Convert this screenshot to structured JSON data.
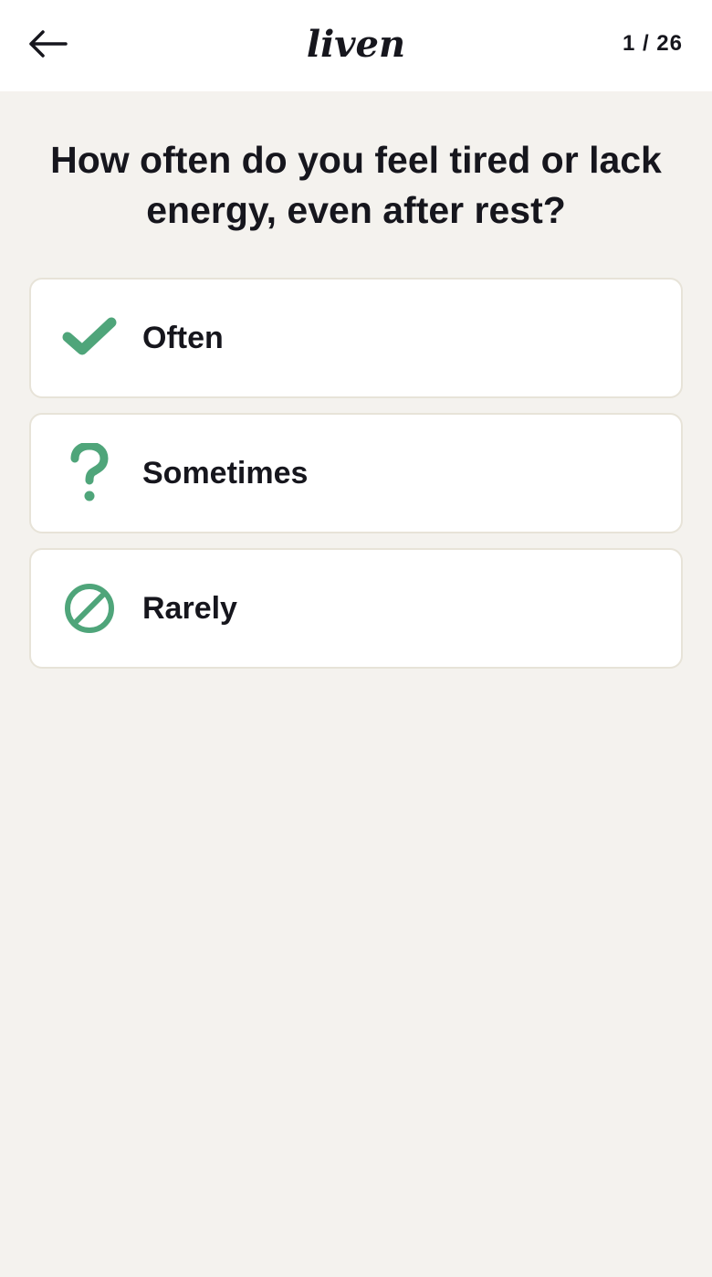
{
  "header": {
    "back_icon": "arrow-left-icon",
    "logo_text": "liven",
    "progress_text": "1 / 26"
  },
  "question": {
    "text": "How often do you feel tired or lack energy, even after rest?"
  },
  "options": [
    {
      "label": "Often",
      "icon": "checkmark-icon"
    },
    {
      "label": "Sometimes",
      "icon": "question-mark-icon"
    },
    {
      "label": "Rarely",
      "icon": "prohibited-icon"
    }
  ],
  "colors": {
    "accent_green": "#4fa57a",
    "background": "#f4f2ee",
    "card_border": "#e7e3d8",
    "text": "#16161d"
  }
}
